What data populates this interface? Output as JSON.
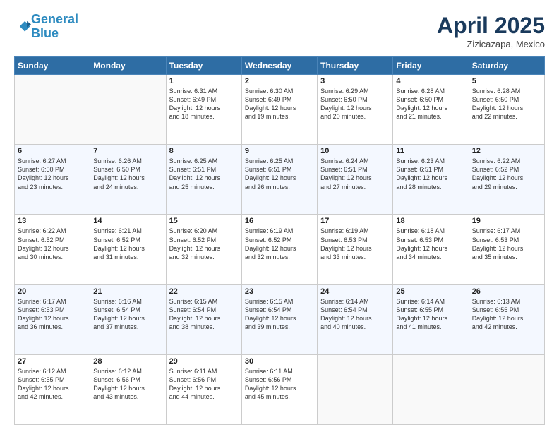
{
  "header": {
    "logo_line1": "General",
    "logo_line2": "Blue",
    "month": "April 2025",
    "location": "Zizicazapa, Mexico"
  },
  "weekdays": [
    "Sunday",
    "Monday",
    "Tuesday",
    "Wednesday",
    "Thursday",
    "Friday",
    "Saturday"
  ],
  "weeks": [
    [
      {
        "day": "",
        "text": ""
      },
      {
        "day": "",
        "text": ""
      },
      {
        "day": "1",
        "text": "Sunrise: 6:31 AM\nSunset: 6:49 PM\nDaylight: 12 hours\nand 18 minutes."
      },
      {
        "day": "2",
        "text": "Sunrise: 6:30 AM\nSunset: 6:49 PM\nDaylight: 12 hours\nand 19 minutes."
      },
      {
        "day": "3",
        "text": "Sunrise: 6:29 AM\nSunset: 6:50 PM\nDaylight: 12 hours\nand 20 minutes."
      },
      {
        "day": "4",
        "text": "Sunrise: 6:28 AM\nSunset: 6:50 PM\nDaylight: 12 hours\nand 21 minutes."
      },
      {
        "day": "5",
        "text": "Sunrise: 6:28 AM\nSunset: 6:50 PM\nDaylight: 12 hours\nand 22 minutes."
      }
    ],
    [
      {
        "day": "6",
        "text": "Sunrise: 6:27 AM\nSunset: 6:50 PM\nDaylight: 12 hours\nand 23 minutes."
      },
      {
        "day": "7",
        "text": "Sunrise: 6:26 AM\nSunset: 6:50 PM\nDaylight: 12 hours\nand 24 minutes."
      },
      {
        "day": "8",
        "text": "Sunrise: 6:25 AM\nSunset: 6:51 PM\nDaylight: 12 hours\nand 25 minutes."
      },
      {
        "day": "9",
        "text": "Sunrise: 6:25 AM\nSunset: 6:51 PM\nDaylight: 12 hours\nand 26 minutes."
      },
      {
        "day": "10",
        "text": "Sunrise: 6:24 AM\nSunset: 6:51 PM\nDaylight: 12 hours\nand 27 minutes."
      },
      {
        "day": "11",
        "text": "Sunrise: 6:23 AM\nSunset: 6:51 PM\nDaylight: 12 hours\nand 28 minutes."
      },
      {
        "day": "12",
        "text": "Sunrise: 6:22 AM\nSunset: 6:52 PM\nDaylight: 12 hours\nand 29 minutes."
      }
    ],
    [
      {
        "day": "13",
        "text": "Sunrise: 6:22 AM\nSunset: 6:52 PM\nDaylight: 12 hours\nand 30 minutes."
      },
      {
        "day": "14",
        "text": "Sunrise: 6:21 AM\nSunset: 6:52 PM\nDaylight: 12 hours\nand 31 minutes."
      },
      {
        "day": "15",
        "text": "Sunrise: 6:20 AM\nSunset: 6:52 PM\nDaylight: 12 hours\nand 32 minutes."
      },
      {
        "day": "16",
        "text": "Sunrise: 6:19 AM\nSunset: 6:52 PM\nDaylight: 12 hours\nand 32 minutes."
      },
      {
        "day": "17",
        "text": "Sunrise: 6:19 AM\nSunset: 6:53 PM\nDaylight: 12 hours\nand 33 minutes."
      },
      {
        "day": "18",
        "text": "Sunrise: 6:18 AM\nSunset: 6:53 PM\nDaylight: 12 hours\nand 34 minutes."
      },
      {
        "day": "19",
        "text": "Sunrise: 6:17 AM\nSunset: 6:53 PM\nDaylight: 12 hours\nand 35 minutes."
      }
    ],
    [
      {
        "day": "20",
        "text": "Sunrise: 6:17 AM\nSunset: 6:53 PM\nDaylight: 12 hours\nand 36 minutes."
      },
      {
        "day": "21",
        "text": "Sunrise: 6:16 AM\nSunset: 6:54 PM\nDaylight: 12 hours\nand 37 minutes."
      },
      {
        "day": "22",
        "text": "Sunrise: 6:15 AM\nSunset: 6:54 PM\nDaylight: 12 hours\nand 38 minutes."
      },
      {
        "day": "23",
        "text": "Sunrise: 6:15 AM\nSunset: 6:54 PM\nDaylight: 12 hours\nand 39 minutes."
      },
      {
        "day": "24",
        "text": "Sunrise: 6:14 AM\nSunset: 6:54 PM\nDaylight: 12 hours\nand 40 minutes."
      },
      {
        "day": "25",
        "text": "Sunrise: 6:14 AM\nSunset: 6:55 PM\nDaylight: 12 hours\nand 41 minutes."
      },
      {
        "day": "26",
        "text": "Sunrise: 6:13 AM\nSunset: 6:55 PM\nDaylight: 12 hours\nand 42 minutes."
      }
    ],
    [
      {
        "day": "27",
        "text": "Sunrise: 6:12 AM\nSunset: 6:55 PM\nDaylight: 12 hours\nand 42 minutes."
      },
      {
        "day": "28",
        "text": "Sunrise: 6:12 AM\nSunset: 6:56 PM\nDaylight: 12 hours\nand 43 minutes."
      },
      {
        "day": "29",
        "text": "Sunrise: 6:11 AM\nSunset: 6:56 PM\nDaylight: 12 hours\nand 44 minutes."
      },
      {
        "day": "30",
        "text": "Sunrise: 6:11 AM\nSunset: 6:56 PM\nDaylight: 12 hours\nand 45 minutes."
      },
      {
        "day": "",
        "text": ""
      },
      {
        "day": "",
        "text": ""
      },
      {
        "day": "",
        "text": ""
      }
    ]
  ]
}
